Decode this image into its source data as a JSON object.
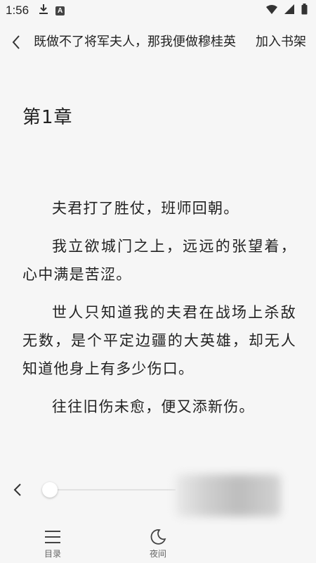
{
  "status_bar": {
    "time": "1:56",
    "app_badge": "A"
  },
  "header": {
    "book_title": "既做不了将军夫人，那我便做穆桂英",
    "add_to_shelf": "加入书架"
  },
  "chapter": {
    "title": "第1章",
    "paragraphs": [
      "夫君打了胜仗，班师回朝。",
      "我立欲城门之上，远远的张望着，心中满是苦涩。",
      "世人只知道我的夫君在战场上杀敌无数，是个平定边疆的大英雄，却无人知道他身上有多少伤口。",
      "往往旧伤未愈，便又添新伤。"
    ]
  },
  "bottom_bar": {
    "catalog_label": "目录",
    "night_label": "夜间",
    "progress": 0
  }
}
